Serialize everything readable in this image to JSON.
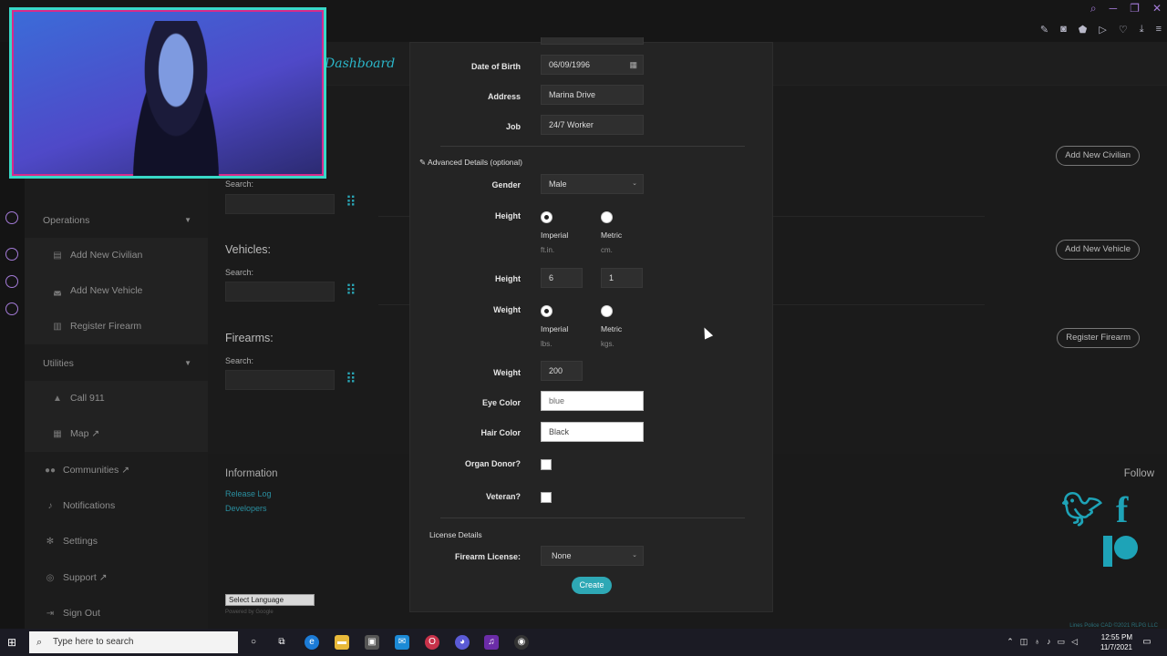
{
  "dashboard_title": "Dashboard",
  "sidebar": {
    "operations": "Operations",
    "add_civilian": "Add New Civilian",
    "add_vehicle": "Add New Vehicle",
    "register_firearm": "Register Firearm",
    "utilities": "Utilities",
    "call_911": "Call 911",
    "map": "Map",
    "communities": "Communities",
    "notifications": "Notifications",
    "settings": "Settings",
    "support": "Support",
    "sign_out": "Sign Out"
  },
  "main": {
    "search_label": "Search:",
    "vehicles_title": "Vehicles:",
    "firearms_title": "Firearms:",
    "add_civilian_btn": "Add New Civilian",
    "add_vehicle_btn": "Add New Vehicle",
    "register_firearm_btn": "Register Firearm"
  },
  "footer": {
    "information": "Information",
    "release_log": "Release Log",
    "developers": "Developers",
    "follow": "Follow",
    "select_language": "Select Language",
    "powered_by": "Powered by Google",
    "copyright": "Lines Police CAD ©2021 RLPG LLC"
  },
  "form": {
    "dob_label": "Date of Birth",
    "dob_value": "06/09/1996",
    "address_label": "Address",
    "address_value": "Marina Drive",
    "job_label": "Job",
    "job_value": "24/7 Worker",
    "advanced_label": "Advanced Details (optional)",
    "gender_label": "Gender",
    "gender_value": "Male",
    "height_label": "Height",
    "imperial": "Imperial",
    "metric": "Metric",
    "height_imperial_unit": "ft.in.",
    "height_metric_unit": "cm.",
    "height_ft": "6",
    "height_in": "1",
    "weight_label": "Weight",
    "weight_imperial_unit": "lbs.",
    "weight_metric_unit": "kgs.",
    "weight_value": "200",
    "eye_label": "Eye Color",
    "eye_value": "blue",
    "hair_label": "Hair Color",
    "hair_value": "Black",
    "organ_label": "Organ Donor?",
    "veteran_label": "Veteran?",
    "license_details": "License Details",
    "firearm_license_label": "Firearm License:",
    "firearm_license_value": "None",
    "create": "Create"
  },
  "taskbar": {
    "search_placeholder": "Type here to search",
    "time": "12:55 PM",
    "date": "11/7/2021"
  }
}
